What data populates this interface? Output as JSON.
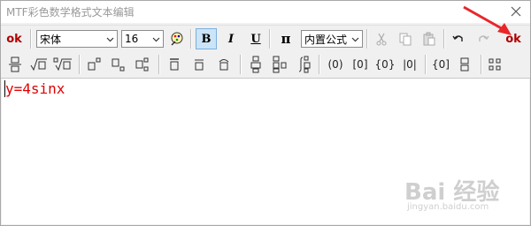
{
  "window": {
    "title": "MTF彩色数学格式文本编辑"
  },
  "toolbar1": {
    "ok_left": "ok",
    "font_name": "宋体",
    "font_size": "16",
    "bold": "B",
    "italic": "I",
    "underline": "U",
    "pi": "π",
    "formula_style": "内置公式",
    "ok_right": "ok"
  },
  "toolbar2": {
    "paren": "(0)",
    "bracket": "[0]",
    "brace": "{0}",
    "abs": "|0|",
    "brace_bracket": "{0]"
  },
  "editor": {
    "content": "y=4sinx"
  },
  "watermark": {
    "brand": "Bai 经验",
    "url": "jingyan.baidu.com"
  },
  "colors": {
    "ok": "#b00000",
    "content": "#e00000",
    "arrow": "#e8262a",
    "active": "#cce4f7"
  },
  "icons": [
    "close-icon",
    "font-color-icon",
    "cut-icon",
    "copy-icon",
    "paste-icon",
    "undo-icon",
    "redo-icon",
    "fraction-icon",
    "sqrt-icon",
    "nth-root-icon",
    "grid-icon"
  ]
}
